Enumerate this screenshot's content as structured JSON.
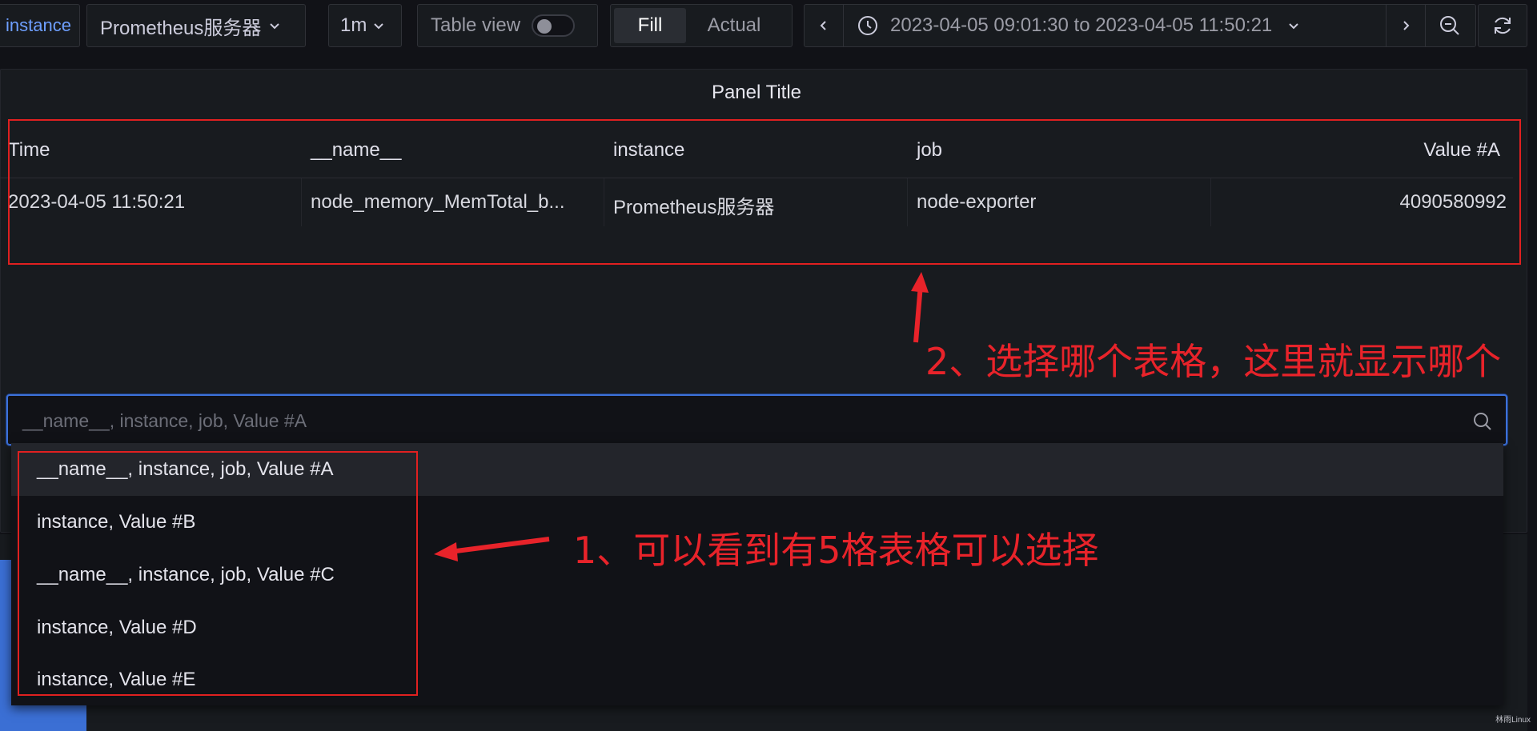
{
  "toolbar": {
    "variable_label": "instance",
    "datasource_value": "Prometheus服务器",
    "interval_value": "1m",
    "table_view_label": "Table view",
    "fill_label": "Fill",
    "actual_label": "Actual",
    "time_range": "2023-04-05 09:01:30 to 2023-04-05 11:50:21"
  },
  "panel": {
    "title": "Panel Title",
    "columns": [
      "Time",
      "__name__",
      "instance",
      "job",
      "Value #A"
    ],
    "rows": [
      [
        "2023-04-05 11:50:21",
        "node_memory_MemTotal_b...",
        "Prometheus服务器",
        "node-exporter",
        "4090580992"
      ]
    ]
  },
  "frame_select": {
    "placeholder": "__name__, instance, job, Value #A",
    "options": [
      "__name__, instance, job, Value #A",
      "instance, Value #B",
      "__name__, instance, job, Value #C",
      "instance, Value #D",
      "instance, Value #E"
    ]
  },
  "annotations": {
    "note1": "1、可以看到有5格表格可以选择",
    "note2": "2、选择哪个表格，这里就显示哪个"
  },
  "watermark": "林雨Linux",
  "colors": {
    "background": "#111217",
    "panel": "#181b1f",
    "focus_border": "#3d71d9",
    "annotation_red": "#e02020",
    "variable_link": "#6e9fff"
  },
  "toggle_table_view": false,
  "selected_mode": "Fill"
}
